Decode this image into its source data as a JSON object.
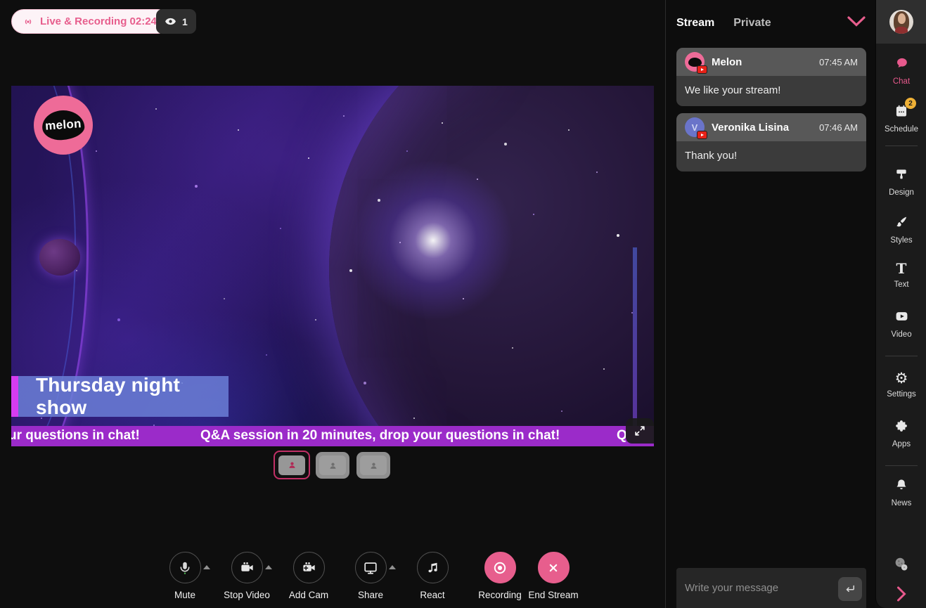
{
  "topbar": {
    "live_badge_label": "Live & Recording 02:24",
    "viewer_count": "1"
  },
  "stage": {
    "logo_text": "melon",
    "title_overlay": "Thursday night show",
    "ticker_segment_left": "ur questions in chat!",
    "ticker_message": "Q&A session in 20 minutes, drop your questions in chat!",
    "ticker_segment_right": "Q"
  },
  "toolbar": {
    "buttons": [
      {
        "label": "Mute"
      },
      {
        "label": "Stop Video"
      },
      {
        "label": "Add Cam"
      },
      {
        "label": "Share"
      },
      {
        "label": "React"
      },
      {
        "label": "Recording"
      },
      {
        "label": "End Stream"
      }
    ]
  },
  "chat": {
    "tabs": [
      {
        "label": "Stream"
      },
      {
        "label": "Private"
      }
    ],
    "messages": [
      {
        "author": "Melon",
        "time": "07:45 AM",
        "text": "We like your stream!"
      },
      {
        "author": "Veronika Lisina",
        "time": "07:46 AM",
        "text": "Thank you!",
        "avatar_initial": "V"
      }
    ],
    "input_placeholder": "Write your message"
  },
  "sidebar": {
    "items": [
      {
        "label": "Chat",
        "active": true
      },
      {
        "label": "Schedule",
        "badge": "2"
      },
      {
        "label": "Design"
      },
      {
        "label": "Styles"
      },
      {
        "label": "Text"
      },
      {
        "label": "Video"
      },
      {
        "label": "Settings"
      },
      {
        "label": "Apps"
      },
      {
        "label": "News"
      }
    ]
  },
  "colors": {
    "accent_pink": "#e75e8d",
    "badge_amber": "#eeb036",
    "ticker_purple": "#9b2bc9",
    "title_box_blue": "#6b7fd7",
    "title_bar_magenta": "#d63cf0",
    "youtube_red": "#e62117"
  }
}
